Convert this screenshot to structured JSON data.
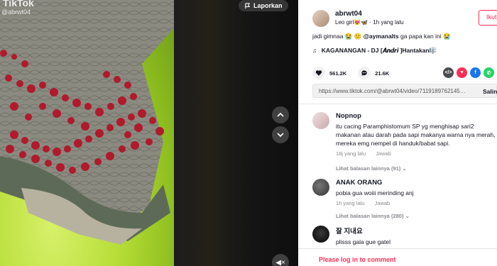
{
  "video": {
    "watermark_brand": "TikTok",
    "watermark_user": "@abrwt04",
    "report_label": "Laporkan",
    "mute_glyph": "◀×"
  },
  "author": {
    "username": "abrwt04",
    "nickname": "Leo girl😻🦋",
    "time": "1h yang lalu",
    "follow_label": "Ikuti"
  },
  "caption": {
    "text": "jadi gimnaa 😭 😕 ",
    "mention": "@aymanalts",
    "tail": " ga papa kan ini 😭"
  },
  "music": {
    "icon": "music-note-icon",
    "title": "KAGANANGAN - DJ [𝑨𝒏𝒅𝒓𝒊 ]Hantakan🎼"
  },
  "stats": {
    "likes": "561.2K",
    "comments": "21.6K"
  },
  "share": {
    "link": "https://www.tiktok.com/@abrwt04/video/7119189762145…",
    "copy_label": "Salin"
  },
  "comments": [
    {
      "name": "Nopnop",
      "text": "itu cacing Paramphistomum SP yg menghisap sari2 makanan atau darah pada sapi makanya warna nya merah, mereka emg nempel di handuk/babat sapi.",
      "time": "18j yang lalu",
      "reply_label": "Jawab",
      "more_replies": "Lihat balasan lainnya (91)"
    },
    {
      "name": "ANAK ORANG",
      "text": "pobia gua woiii merinding anj",
      "time": "1h yang lalu",
      "reply_label": "Jawab",
      "more_replies": "Lihat balasan lainnya (280)"
    },
    {
      "name": "잘 지내요",
      "text": "plisss gala gue gatel"
    }
  ],
  "login": {
    "prompt": "Please log in to comment"
  },
  "colors": {
    "accent": "#fe2c55",
    "text": "#161823",
    "muted": "#8a8b91"
  }
}
